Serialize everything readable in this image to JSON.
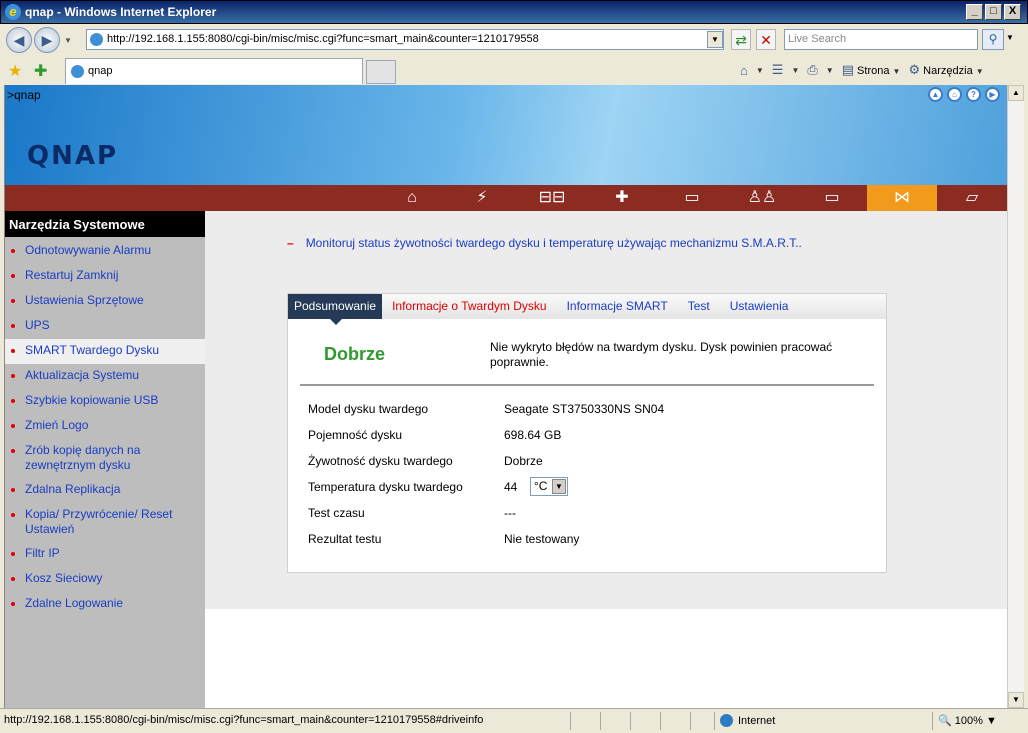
{
  "window": {
    "title": "qnap - Windows Internet Explorer",
    "buttons": {
      "minimize": "_",
      "maximize": "□",
      "close": "X"
    }
  },
  "address": {
    "url": "http://192.168.1.155:8080/cgi-bin/misc/misc.cgi?func=smart_main&counter=1210179558",
    "search_placeholder": "Live Search"
  },
  "tabs": {
    "current": "qnap"
  },
  "ie_toolbar": {
    "page_label": "Strona",
    "tools_label": "Narzędzia"
  },
  "qnap": {
    "breadcrumb": ">qnap",
    "logo": "QNAP",
    "menu_icons": [
      "home-icon",
      "lightning-icon",
      "network-icon",
      "plus-icon",
      "drive-icon",
      "users-icon",
      "folder-icon",
      "tools-icon",
      "document-icon"
    ],
    "active_menu": "tools-icon"
  },
  "sidebar": {
    "title": "Narzędzia Systemowe",
    "items": [
      "Odnotowywanie Alarmu",
      "Restartuj Zamknij",
      "Ustawienia Sprzętowe",
      "UPS",
      "SMART Twardego Dysku",
      "Aktualizacja Systemu",
      "Szybkie kopiowanie USB",
      "Zmień Logo",
      "Zrób kopię danych na zewnętrznym dysku",
      "Zdalna Replikacja",
      "Kopia/ Przywrócenie/ Reset Ustawień",
      "Filtr IP",
      "Kosz Sieciowy",
      "Zdalne Logowanie"
    ],
    "active_index": 4
  },
  "main": {
    "description": "Monitoruj status żywotności twardego dysku i temperaturę używając mechanizmu S.M.A.R.T..",
    "tabs": [
      "Podsumowanie",
      "Informacje o Twardym Dysku",
      "Informacje SMART",
      "Test",
      "Ustawienia"
    ],
    "status": "Dobrze",
    "status_message": "Nie wykryto błędów na twardym dysku. Dysk powinien pracować poprawnie.",
    "details": [
      {
        "label": "Model dysku twardego",
        "value": "Seagate ST3750330NS SN04"
      },
      {
        "label": "Pojemność dysku",
        "value": "698.64 GB"
      },
      {
        "label": "Żywotność dysku twardego",
        "value": "Dobrze"
      },
      {
        "label": "Temperatura dysku twardego",
        "value": "44"
      },
      {
        "label": "Test czasu",
        "value": "---"
      },
      {
        "label": "Rezultat testu",
        "value": "Nie testowany"
      }
    ],
    "temp_unit": "°C"
  },
  "statusbar": {
    "url": "http://192.168.1.155:8080/cgi-bin/misc/misc.cgi?func=smart_main&counter=1210179558#driveinfo",
    "zone": "Internet",
    "zoom": "100%"
  }
}
